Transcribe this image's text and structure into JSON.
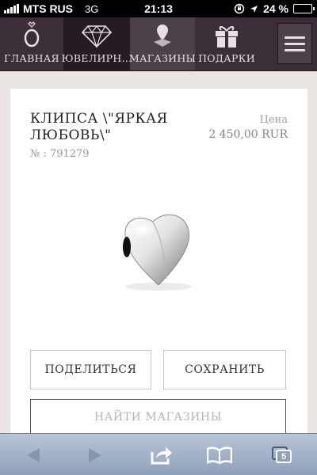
{
  "status_bar": {
    "carrier": "MTS RUS",
    "network": "3G",
    "time": "21:13",
    "battery_text": "24 %",
    "battery_level": 0.24
  },
  "nav": {
    "items": [
      {
        "label": "ГЛАВНАЯ",
        "icon": "pandora-logo-icon"
      },
      {
        "label": "ЮВЕЛИРН...",
        "icon": "diamond-icon"
      },
      {
        "label": "МАГАЗИНЫ",
        "icon": "map-pin-icon"
      },
      {
        "label": "ПОДАРКИ",
        "icon": "gift-icon"
      }
    ],
    "menu_icon": "hamburger-menu-icon"
  },
  "product": {
    "title": "КЛИПСА \\\"ЯРКАЯ ЛЮБОВЬ\\\"",
    "number": "№ : 791279",
    "price_label": "Цена",
    "price": "2 450,00 RUR"
  },
  "actions": {
    "share_label": "ПОДЕЛИТЬСЯ",
    "save_label": "СОХРАНИТЬ",
    "find_stores_label": "НАЙТИ МАГАЗИНЫ"
  },
  "browser_toolbar": {
    "tabs_count": "5"
  },
  "colors": {
    "nav_background": "#3a2e38",
    "nav_active": "#251c23",
    "page_background": "#ebe6e4",
    "toolbar": "#a3b2c9"
  }
}
